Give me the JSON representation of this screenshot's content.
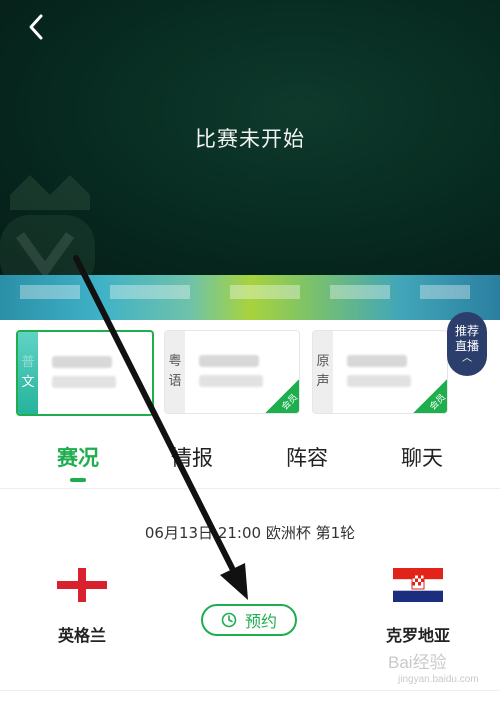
{
  "video": {
    "status_text": "比赛未开始",
    "back_icon": "back-arrow-icon"
  },
  "commentary": [
    {
      "lang": "文",
      "selected": true,
      "badge": ""
    },
    {
      "lang": "粤语",
      "selected": false,
      "badge": "会员"
    },
    {
      "lang": "原声",
      "selected": false,
      "badge": "会员"
    }
  ],
  "recommend": {
    "line1": "推荐",
    "line2": "直播",
    "icon": "chevron-up-icon"
  },
  "tabs": [
    {
      "label": "赛况",
      "active": true
    },
    {
      "label": "情报",
      "active": false
    },
    {
      "label": "阵容",
      "active": false
    },
    {
      "label": "聊天",
      "active": false
    }
  ],
  "match": {
    "info": "06月13日 21:00 欧洲杯 第1轮",
    "home_team": "英格兰",
    "away_team": "克罗地亚",
    "reserve_label": "预约",
    "reserve_icon": "clock-icon"
  },
  "watermark": {
    "text": "Bai经验",
    "url": "jingyan.baidu.com"
  },
  "colors": {
    "accent": "#1fae4e",
    "video_bg": "#072a20",
    "recommend_bg": "#2c3e6b"
  }
}
